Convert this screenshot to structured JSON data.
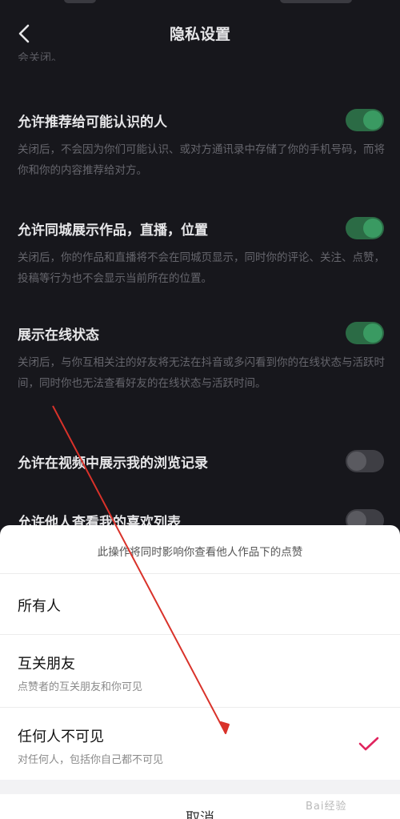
{
  "header": {
    "title": "隐私设置",
    "cut_text": "会关闭。"
  },
  "settings": [
    {
      "title": "允许推荐给可能认识的人",
      "desc": "关闭后，不会因为你们可能认识、或对方通讯录中存储了你的手机号码，而将你和你的内容推荐给对方。",
      "enabled": true
    },
    {
      "title": "允许同城展示作品，直播，位置",
      "desc": "关闭后，你的作品和直播将不会在同城页显示，同时你的评论、关注、点赞，投稿等行为也不会显示当前所在的位置。",
      "enabled": true
    },
    {
      "title": "展示在线状态",
      "desc": "关闭后，与你互相关注的好友将无法在抖音或多闪看到你的在线状态与活跃时间，同时你也无法查看好友的在线状态与活跃时间。",
      "enabled": true
    },
    {
      "title": "允许在视频中展示我的浏览记录",
      "desc": "",
      "enabled": false
    },
    {
      "title": "允许他人查看我的喜欢列表",
      "desc": "",
      "enabled": false
    }
  ],
  "sheet": {
    "note": "此操作将同时影响你查看他人作品下的点赞",
    "options": [
      {
        "title": "所有人",
        "sub": "",
        "selected": false
      },
      {
        "title": "互关朋友",
        "sub": "点赞者的互关朋友和你可见",
        "selected": false
      },
      {
        "title": "任何人不可见",
        "sub": "对任何人，包括你自己都不可见",
        "selected": true
      }
    ],
    "cancel": "取消"
  },
  "watermark": "Bai经验",
  "colors": {
    "toggle_on": "#3a9a62",
    "check": "#e0245e",
    "annotation_arrow": "#d9322a"
  },
  "icons": {
    "back": "chevron-left-icon",
    "check": "checkmark-icon"
  }
}
